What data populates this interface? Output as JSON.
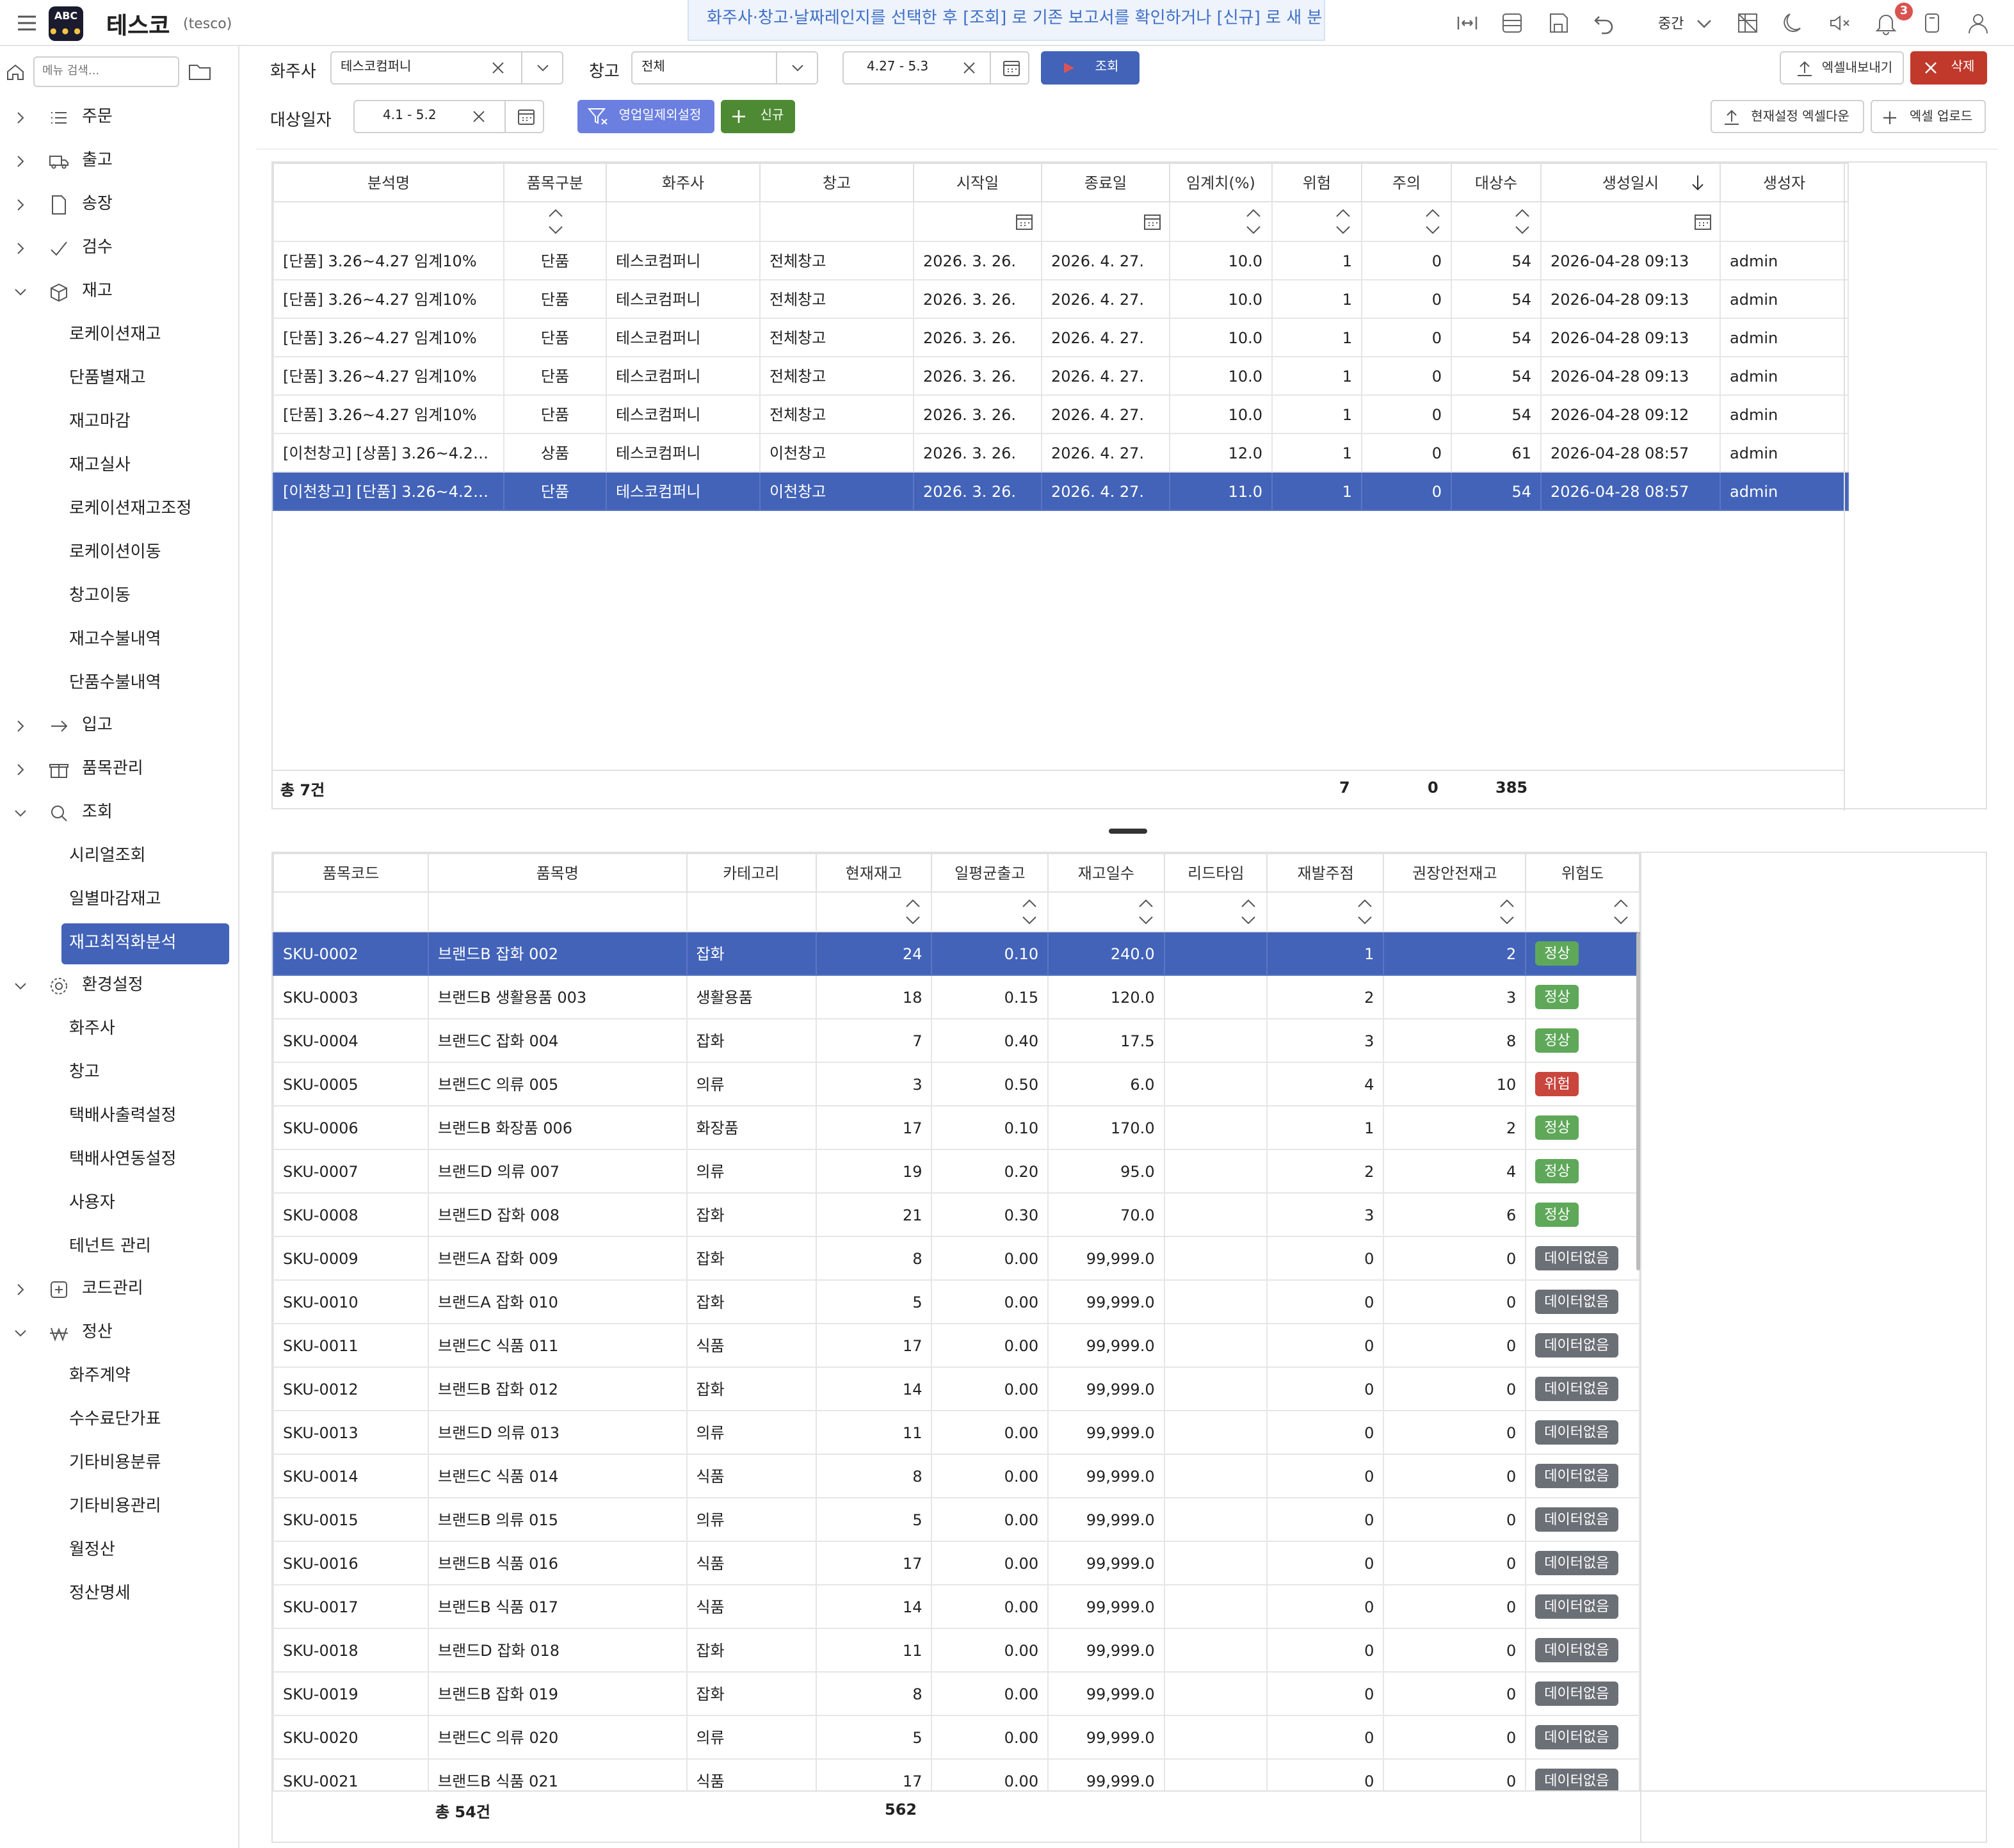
{
  "app": {
    "title": "테스코",
    "tenant": "(tesco)",
    "logo_text": "ABC"
  },
  "hint": "화주사·창고·날짜레인지를 선택한 후 [조회] 로 기존 보고서를 확인하거나 [신규] 로 새 분",
  "topbar": {
    "size_label": "중간",
    "notification_count": "3"
  },
  "sidebar": {
    "search_placeholder": "메뉴 검색...",
    "menus": [
      {
        "label": "주문"
      },
      {
        "label": "출고"
      },
      {
        "label": "송장"
      },
      {
        "label": "검수"
      },
      {
        "label": "재고"
      },
      {
        "label": "입고"
      },
      {
        "label": "품목관리"
      },
      {
        "label": "조회"
      },
      {
        "label": "환경설정"
      },
      {
        "label": "코드관리"
      },
      {
        "label": "정산"
      }
    ],
    "inventory_sub": [
      "로케이션재고",
      "단품별재고",
      "재고마감",
      "재고실사",
      "로케이션재고조정",
      "로케이션이동",
      "창고이동",
      "재고수불내역",
      "단품수불내역"
    ],
    "query_sub": [
      "시리얼조회",
      "일별마감재고",
      "재고최적화분석"
    ],
    "settings_sub": [
      "화주사",
      "창고",
      "택배사출력설정",
      "택배사연동설정",
      "사용자",
      "테넌트 관리"
    ],
    "settle_sub": [
      "화주계약",
      "수수료단가표",
      "기타비용분류",
      "기타비용관리",
      "월정산",
      "정산명세"
    ]
  },
  "filters": {
    "shipper_label": "화주사",
    "shipper_value": "테스코컴퍼니",
    "warehouse_label": "창고",
    "warehouse_value": "전체",
    "range_value": "4.27 - 5.3",
    "query_btn": "조회",
    "export_btn": "엑셀내보내기",
    "delete_btn": "삭제",
    "target_label": "대상일자",
    "target_value": "4.1 - 5.2",
    "biz_btn": "영업일제외설정",
    "new_btn": "신규",
    "cfg_excel_btn": "현재설정 엑셀다운",
    "upload_btn": "엑셀 업로드"
  },
  "grid1": {
    "headers": [
      "분석명",
      "품목구분",
      "화주사",
      "창고",
      "시작일",
      "종료일",
      "임계치(%)",
      "위험",
      "주의",
      "대상수",
      "생성일시",
      "생성자"
    ],
    "rows": [
      [
        "[단품] 3.26~4.27 임계10%",
        "단품",
        "테스코컴퍼니",
        "전체창고",
        "2026. 3. 26.",
        "2026. 4. 27.",
        "10.0",
        "1",
        "0",
        "54",
        "2026-04-28 09:13",
        "admin"
      ],
      [
        "[단품] 3.26~4.27 임계10%",
        "단품",
        "테스코컴퍼니",
        "전체창고",
        "2026. 3. 26.",
        "2026. 4. 27.",
        "10.0",
        "1",
        "0",
        "54",
        "2026-04-28 09:13",
        "admin"
      ],
      [
        "[단품] 3.26~4.27 임계10%",
        "단품",
        "테스코컴퍼니",
        "전체창고",
        "2026. 3. 26.",
        "2026. 4. 27.",
        "10.0",
        "1",
        "0",
        "54",
        "2026-04-28 09:13",
        "admin"
      ],
      [
        "[단품] 3.26~4.27 임계10%",
        "단품",
        "테스코컴퍼니",
        "전체창고",
        "2026. 3. 26.",
        "2026. 4. 27.",
        "10.0",
        "1",
        "0",
        "54",
        "2026-04-28 09:13",
        "admin"
      ],
      [
        "[단품] 3.26~4.27 임계10%",
        "단품",
        "테스코컴퍼니",
        "전체창고",
        "2026. 3. 26.",
        "2026. 4. 27.",
        "10.0",
        "1",
        "0",
        "54",
        "2026-04-28 09:12",
        "admin"
      ],
      [
        "[이천창고] [상품] 3.26~4.27 ...",
        "상품",
        "테스코컴퍼니",
        "이천창고",
        "2026. 3. 26.",
        "2026. 4. 27.",
        "12.0",
        "1",
        "0",
        "61",
        "2026-04-28 08:57",
        "admin"
      ],
      [
        "[이천창고] [단품] 3.26~4.27 ...",
        "단품",
        "테스코컴퍼니",
        "이천창고",
        "2026. 3. 26.",
        "2026. 4. 27.",
        "11.0",
        "1",
        "0",
        "54",
        "2026-04-28 08:57",
        "admin"
      ]
    ],
    "footer": {
      "total": "총 7건",
      "risk": "7",
      "caution": "0",
      "targets": "385"
    }
  },
  "grid2": {
    "headers": [
      "품목코드",
      "품목명",
      "카테고리",
      "현재재고",
      "일평균출고",
      "재고일수",
      "리드타임",
      "재발주점",
      "권장안전재고",
      "위험도"
    ],
    "rows": [
      [
        "SKU-0002",
        "브랜드B 잡화 002",
        "잡화",
        "24",
        "0.10",
        "240.0",
        "",
        "1",
        "2",
        "정상"
      ],
      [
        "SKU-0003",
        "브랜드B 생활용품 003",
        "생활용품",
        "18",
        "0.15",
        "120.0",
        "",
        "2",
        "3",
        "정상"
      ],
      [
        "SKU-0004",
        "브랜드C 잡화 004",
        "잡화",
        "7",
        "0.40",
        "17.5",
        "",
        "3",
        "8",
        "정상"
      ],
      [
        "SKU-0005",
        "브랜드C 의류 005",
        "의류",
        "3",
        "0.50",
        "6.0",
        "",
        "4",
        "10",
        "위험"
      ],
      [
        "SKU-0006",
        "브랜드B 화장품 006",
        "화장품",
        "17",
        "0.10",
        "170.0",
        "",
        "1",
        "2",
        "정상"
      ],
      [
        "SKU-0007",
        "브랜드D 의류 007",
        "의류",
        "19",
        "0.20",
        "95.0",
        "",
        "2",
        "4",
        "정상"
      ],
      [
        "SKU-0008",
        "브랜드D 잡화 008",
        "잡화",
        "21",
        "0.30",
        "70.0",
        "",
        "3",
        "6",
        "정상"
      ],
      [
        "SKU-0009",
        "브랜드A 잡화 009",
        "잡화",
        "8",
        "0.00",
        "99,999.0",
        "",
        "0",
        "0",
        "데이터없음"
      ],
      [
        "SKU-0010",
        "브랜드A 잡화 010",
        "잡화",
        "5",
        "0.00",
        "99,999.0",
        "",
        "0",
        "0",
        "데이터없음"
      ],
      [
        "SKU-0011",
        "브랜드C 식품 011",
        "식품",
        "17",
        "0.00",
        "99,999.0",
        "",
        "0",
        "0",
        "데이터없음"
      ],
      [
        "SKU-0012",
        "브랜드B 잡화 012",
        "잡화",
        "14",
        "0.00",
        "99,999.0",
        "",
        "0",
        "0",
        "데이터없음"
      ],
      [
        "SKU-0013",
        "브랜드D 의류 013",
        "의류",
        "11",
        "0.00",
        "99,999.0",
        "",
        "0",
        "0",
        "데이터없음"
      ],
      [
        "SKU-0014",
        "브랜드C 식품 014",
        "식품",
        "8",
        "0.00",
        "99,999.0",
        "",
        "0",
        "0",
        "데이터없음"
      ],
      [
        "SKU-0015",
        "브랜드B 의류 015",
        "의류",
        "5",
        "0.00",
        "99,999.0",
        "",
        "0",
        "0",
        "데이터없음"
      ],
      [
        "SKU-0016",
        "브랜드B 식품 016",
        "식품",
        "17",
        "0.00",
        "99,999.0",
        "",
        "0",
        "0",
        "데이터없음"
      ],
      [
        "SKU-0017",
        "브랜드B 식품 017",
        "식품",
        "14",
        "0.00",
        "99,999.0",
        "",
        "0",
        "0",
        "데이터없음"
      ],
      [
        "SKU-0018",
        "브랜드D 잡화 018",
        "잡화",
        "11",
        "0.00",
        "99,999.0",
        "",
        "0",
        "0",
        "데이터없음"
      ],
      [
        "SKU-0019",
        "브랜드B 잡화 019",
        "잡화",
        "8",
        "0.00",
        "99,999.0",
        "",
        "0",
        "0",
        "데이터없음"
      ],
      [
        "SKU-0020",
        "브랜드C 의류 020",
        "의류",
        "5",
        "0.00",
        "99,999.0",
        "",
        "0",
        "0",
        "데이터없음"
      ],
      [
        "SKU-0021",
        "브랜드B 식품 021",
        "식품",
        "17",
        "0.00",
        "99,999.0",
        "",
        "0",
        "0",
        "데이터없음"
      ]
    ],
    "footer": {
      "total": "총 54건",
      "stock_sum": "562"
    }
  },
  "colors": {
    "primary": "#4263b8",
    "danger": "#c0392b",
    "success": "#4e9a4e",
    "normal_badge": "#5fa85a",
    "risk_badge": "#c9463d",
    "nodata_badge": "#6b6f76",
    "filter_btn": "#6b7fe0"
  }
}
